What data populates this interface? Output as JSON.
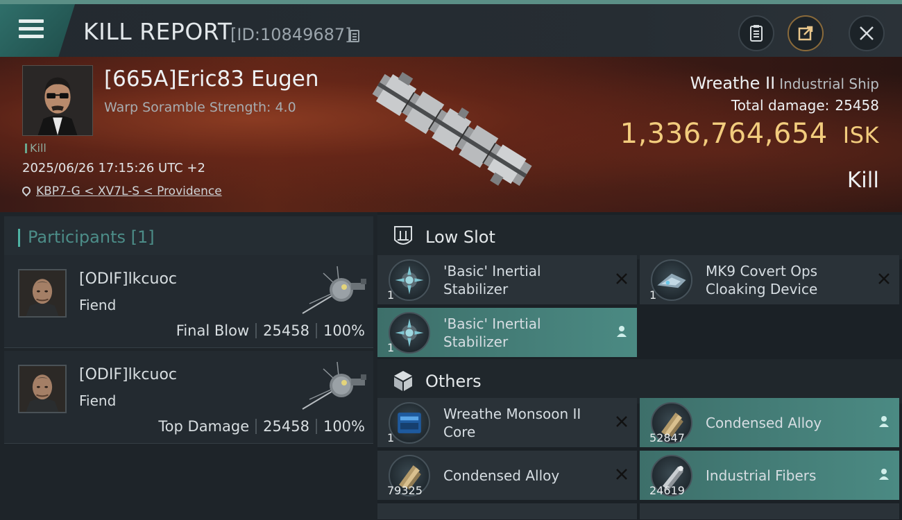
{
  "header": {
    "title": "KILL REPORT",
    "report_id": "[ID:10849687]"
  },
  "victim": {
    "name": "[665A]Eric83 Eugen",
    "warp_scramble": "Warp Soramble Strength: 4.0",
    "tag": "Kill",
    "datetime": "2025/06/26 17:15:26 UTC +2",
    "location": "KBP7-G < XV7L-S < Providence",
    "ship_name": "Wreathe II",
    "ship_class": "Industrial Ship",
    "total_damage_label": "Total damage:",
    "total_damage": "25458",
    "isk_value": "1,336,764,654",
    "isk_unit": "ISK",
    "result": "Kill"
  },
  "participants": {
    "header": "Participants [1]",
    "rows": [
      {
        "name": "[ODIF]lkcuoc",
        "ship": "Fiend",
        "role": "Final Blow",
        "damage": "25458",
        "percent": "100%"
      },
      {
        "name": "[ODIF]lkcuoc",
        "ship": "Fiend",
        "role": "Top Damage",
        "damage": "25458",
        "percent": "100%"
      }
    ]
  },
  "fitting": {
    "low_slot_title": "Low Slot",
    "others_title": "Others",
    "low_slot": [
      {
        "name_line1": "'Basic' Inertial",
        "name_line2": "Stabilizer",
        "qty": "1",
        "status": "destroyed"
      },
      {
        "name_line1": "MK9 Covert Ops",
        "name_line2": "Cloaking Device",
        "qty": "1",
        "status": "destroyed"
      },
      {
        "name_line1": "'Basic' Inertial",
        "name_line2": "Stabilizer",
        "qty": "1",
        "status": "dropped"
      }
    ],
    "others": [
      {
        "name_line1": "Wreathe Monsoon II",
        "name_line2": "Core",
        "qty": "1",
        "status": "destroyed"
      },
      {
        "name_line1": "Condensed Alloy",
        "name_line2": "",
        "qty": "52847",
        "status": "dropped"
      },
      {
        "name_line1": "Condensed Alloy",
        "name_line2": "",
        "qty": "79325",
        "status": "destroyed"
      },
      {
        "name_line1": "Industrial Fibers",
        "name_line2": "",
        "qty": "24619",
        "status": "dropped"
      }
    ]
  },
  "icons": {
    "menu": "hamburger-menu-icon",
    "copy": "copy-icon",
    "notes": "clipboard-icon",
    "share": "share-icon",
    "close": "close-icon",
    "location": "map-pin-icon",
    "low_slot": "low-slot-icon",
    "others": "cube-icon",
    "destroyed": "x-icon",
    "dropped": "person-icon"
  },
  "colors": {
    "accent_teal": "#4fb3a4",
    "isk_gold": "#f2cc7d",
    "highlight_row": "#4b8a83",
    "banner_red": "#5c2517"
  }
}
